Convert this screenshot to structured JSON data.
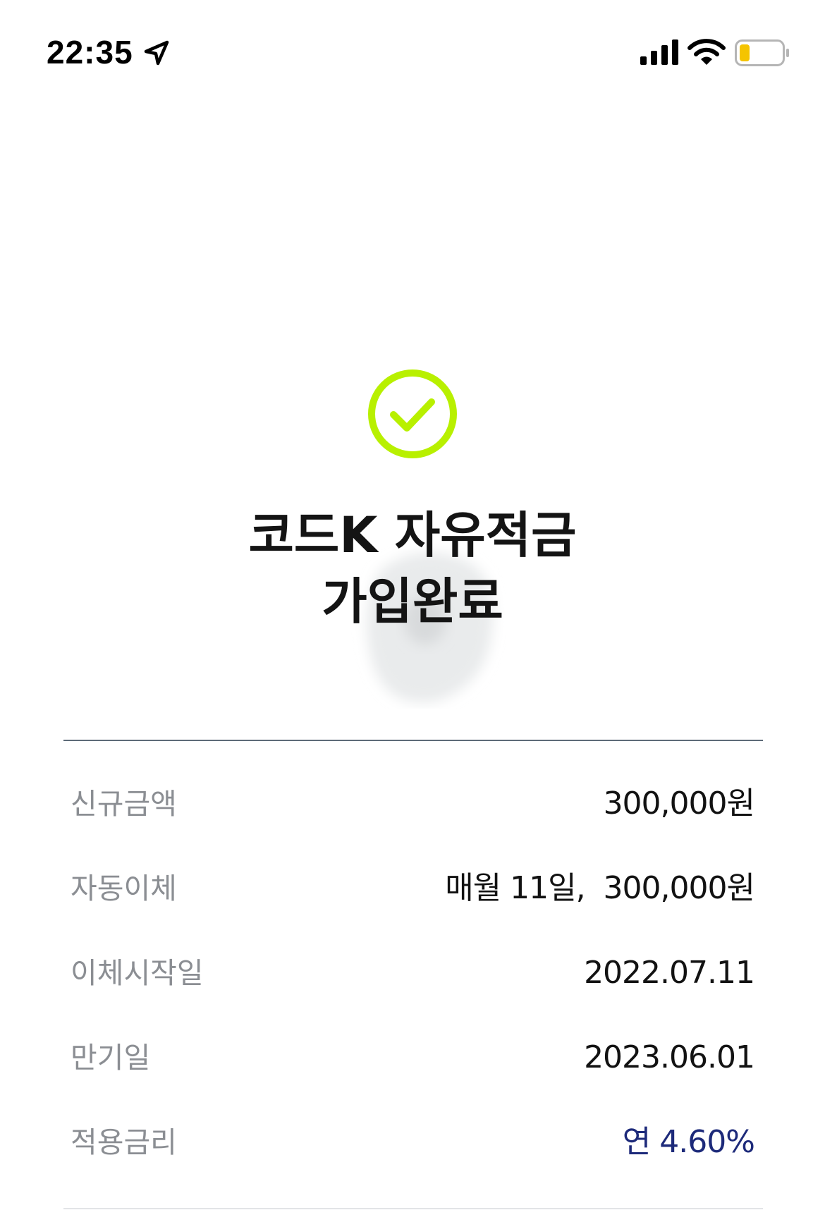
{
  "status_bar": {
    "time": "22:35",
    "icons": [
      "location-arrow-icon",
      "cellular-signal-icon",
      "wifi-icon",
      "battery-low-icon"
    ],
    "battery_color": "#f5c400"
  },
  "success": {
    "icon": "check-circle-icon",
    "accent_color": "#b8f000",
    "title_line1": "코드K 자유적금",
    "title_line2": "가입완료"
  },
  "details": [
    {
      "label": "신규금액",
      "value": "300,000원"
    },
    {
      "label": "자동이체",
      "value": "매월 11일,  300,000원"
    },
    {
      "label": "이체시작일",
      "value": "2022.07.11"
    },
    {
      "label": "만기일",
      "value": "2023.06.01"
    },
    {
      "label": "적용금리",
      "value": "연 4.60%"
    }
  ],
  "colors": {
    "rate_value": "#1d2a7a",
    "label_gray": "#8b8e93",
    "divider": "#5d6b78"
  }
}
